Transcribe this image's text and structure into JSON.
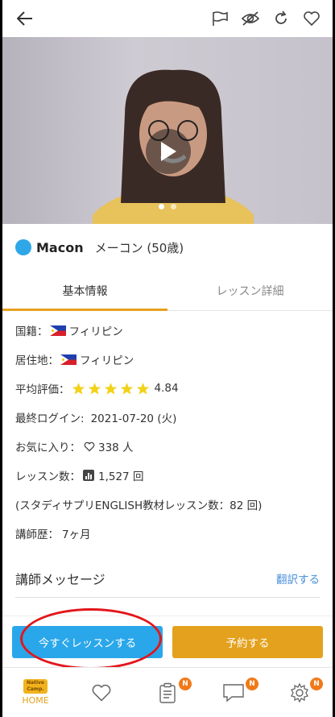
{
  "video": {
    "slide_count": 2,
    "active_slide": 1
  },
  "teacher": {
    "name_en": "Macon",
    "name_ja": "メーコン (50歳)"
  },
  "tabs": [
    {
      "label": "基本情報",
      "active": true
    },
    {
      "label": "レッスン詳細",
      "active": false
    }
  ],
  "info": {
    "nationality_label": "国籍：",
    "nationality_value": "フィリピン",
    "residence_label": "居住地：",
    "residence_value": "フィリピン",
    "rating_label": "平均評価：",
    "rating_value": "4.84",
    "rating_stars": 5,
    "last_login_label": "最終ログイン:",
    "last_login_value": "2021-07-20 (火)",
    "favorites_label": "お気に入り：",
    "favorites_value": "338 人",
    "lessons_label": "レッスン数：",
    "lessons_value": "1,527 回",
    "studysapuri": "(スタディサプリENGLISH教材レッスン数：82 回)",
    "history_label": "講師歴：",
    "history_value": "7ヶ月"
  },
  "message": {
    "title": "講師メッセージ",
    "translate": "翻訳する"
  },
  "buttons": {
    "lesson_now": "今すぐレッスンする",
    "reserve": "予約する"
  },
  "nav": {
    "home_label": "HOME",
    "home_logo": "Native Camp.",
    "badge_text": "N"
  },
  "colors": {
    "accent": "#e3a11d",
    "primary": "#2aa7ea",
    "link": "#4a90d9",
    "star": "#f2d21a",
    "annotation": "#e3161b"
  }
}
